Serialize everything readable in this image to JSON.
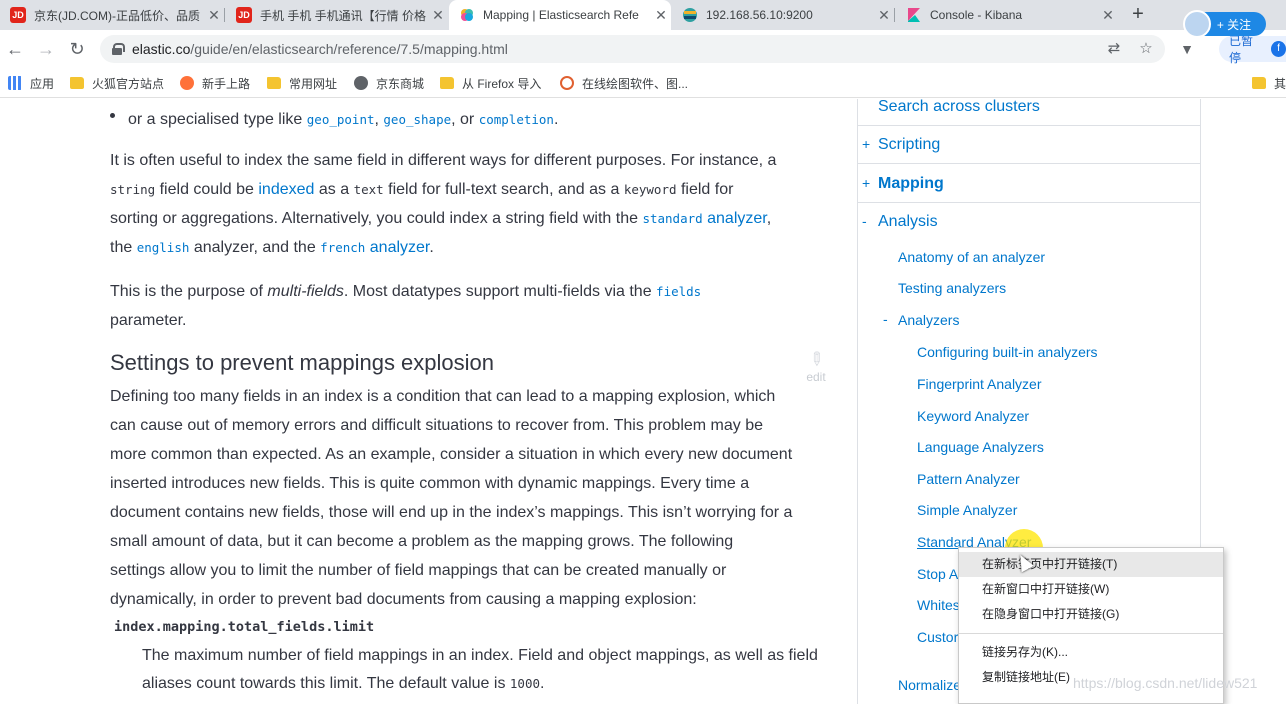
{
  "browser": {
    "tabs": [
      {
        "title": "京东(JD.COM)-正品低价、品质",
        "icon": "jd-icon",
        "favicon_text": "JD",
        "favicon_color": "#e1251b",
        "active": false
      },
      {
        "title": "手机 手机 手机通讯【行情 价格",
        "icon": "jd-icon",
        "favicon_text": "JD",
        "favicon_color": "#e1251b",
        "active": false
      },
      {
        "title": "Mapping | Elasticsearch Refe",
        "icon": "elastic-icon",
        "favicon_text": "",
        "favicon_color": "#f0b32a",
        "active": true
      },
      {
        "title": "192.168.56.10:9200",
        "icon": "elastic-icon",
        "favicon_text": "",
        "favicon_color": "#2ea0a1",
        "active": false
      },
      {
        "title": "Console - Kibana",
        "icon": "kibana-icon",
        "favicon_text": "K",
        "favicon_color": "#e8488b",
        "active": false
      }
    ],
    "new_tab_label": "+",
    "follow_label": "+ 关注",
    "url_host": "elastic.co",
    "url_path": "/guide/en/elasticsearch/reference/7.5/mapping.html",
    "paused_label": "已暂停",
    "paused_initial": "f",
    "bookmarks": [
      {
        "label": "应用",
        "icon": "apps-icon"
      },
      {
        "label": "火狐官方站点",
        "icon": "folder-icon"
      },
      {
        "label": "新手上路",
        "icon": "firefox-icon"
      },
      {
        "label": "常用网址",
        "icon": "folder-icon"
      },
      {
        "label": "京东商城",
        "icon": "globe-icon"
      },
      {
        "label": "从 Firefox 导入",
        "icon": "folder-icon"
      },
      {
        "label": "在线绘图软件、图...",
        "icon": "drawing-icon"
      },
      {
        "label": "其",
        "icon": "folder-icon"
      }
    ]
  },
  "doc": {
    "bullet_prefix": "or a specialised type like",
    "bullet_code1": "geo_point",
    "bullet_code2": "geo_shape",
    "bullet_or": ", or",
    "bullet_code3": "completion",
    "p1": {
      "t1": "It is often useful to index the same field in different ways for different purposes. For instance, a",
      "c_string": "string",
      "t2": "field could be",
      "l_indexed": "indexed",
      "t3": "as a",
      "c_text": "text",
      "t4": "field for full-text search, and as a",
      "c_keyword": "keyword",
      "t5": "field for",
      "t6": "sorting or aggregations. Alternatively, you could index a string field with the",
      "c_standard": "standard",
      "l_analyzer1": "analyzer",
      "t7": "the",
      "c_english": "english",
      "t8": "analyzer, and the",
      "c_french": "french",
      "l_analyzer2": "analyzer"
    },
    "p2": {
      "t1": "This is the purpose of",
      "em": "multi-fields",
      "t2": ". Most datatypes support multi-fields via the",
      "c_fields": "fields",
      "t3": "parameter."
    },
    "heading": "Settings to prevent mappings explosion",
    "edit_label": "edit",
    "p3_lines": [
      "Defining too many fields in an index is a condition that can lead to a mapping explosion, which",
      "can cause out of memory errors and difficult situations to recover from. This problem may be",
      "more common than expected. As an example, consider a situation in which every new document",
      "inserted introduces new fields. This is quite common with dynamic mappings. Every time a",
      "document contains new fields, those will end up in the index’s mappings. This isn’t worrying for a",
      "small amount of data, but it can become a problem as the mapping grows. The following",
      "settings allow you to limit the number of field mappings that can be created manually or",
      "dynamically, in order to prevent bad documents from causing a mapping explosion:"
    ],
    "setting_name": "index.mapping.total_fields.limit",
    "setting_line1": "The maximum number of field mappings in an index. Field and object mappings, as well as field",
    "setting_line2_prefix": "aliases count towards this limit. The default value is",
    "setting_default": "1000",
    "setting_line2_suffix": "."
  },
  "sidebar": {
    "search_across": "Search across clusters",
    "scripting": "Scripting",
    "mapping": "Mapping",
    "analysis": "Analysis",
    "plus": "+",
    "minus": "-",
    "level1": [
      "Anatomy of an analyzer",
      "Testing analyzers"
    ],
    "analyzers": "Analyzers",
    "level2": [
      "Configuring built-in analyzers",
      "Fingerprint Analyzer",
      "Keyword Analyzer",
      "Language Analyzers",
      "Pattern Analyzer",
      "Simple Analyzer",
      "Standard Analyzer",
      "Stop A",
      "Whites",
      "Custor"
    ],
    "normalize": "Normalize"
  },
  "context_menu": {
    "items": [
      "在新标签页中打开链接(T)",
      "在新窗口中打开链接(W)",
      "在隐身窗口中打开链接(G)",
      "链接另存为(K)...",
      "复制链接地址(E)"
    ]
  },
  "watermark": "https://blog.csdn.net/lidew521",
  "colors": {
    "link": "#0077cc",
    "text": "#343741",
    "highlight": "#ffe600"
  }
}
